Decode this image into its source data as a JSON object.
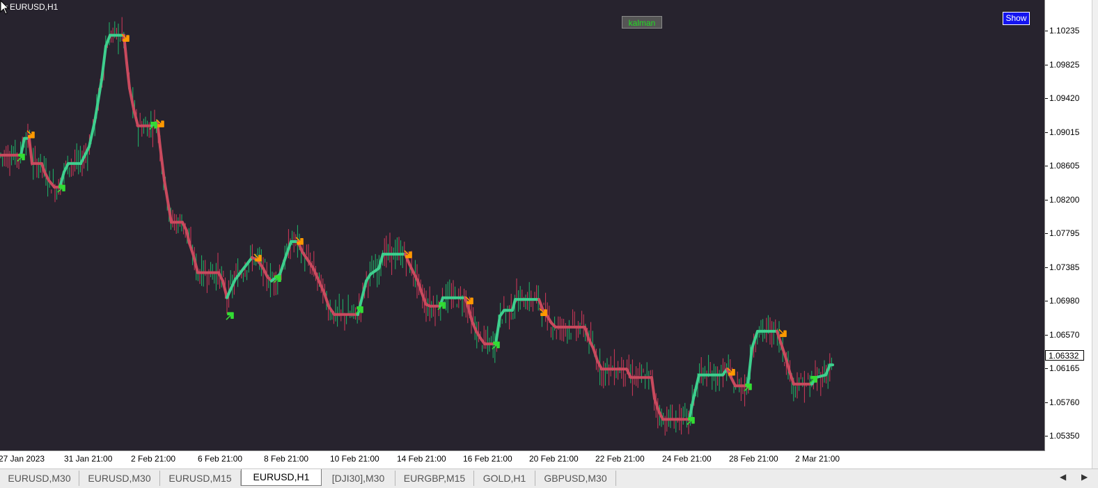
{
  "window": {
    "symbol_title": "EURUSD,H1"
  },
  "buttons": {
    "kalman": "kalman",
    "show": "Show"
  },
  "price_axis": {
    "labels": [
      "1.10235",
      "1.09825",
      "1.09420",
      "1.09015",
      "1.08605",
      "1.08200",
      "1.07795",
      "1.07385",
      "1.06980",
      "1.06570",
      "1.06165",
      "1.05760",
      "1.05350"
    ],
    "current_price": "1.06332"
  },
  "time_axis": {
    "labels": [
      "27 Jan 2023",
      "31 Jan 21:00",
      "2 Feb 21:00",
      "6 Feb 21:00",
      "8 Feb 21:00",
      "10 Feb 21:00",
      "14 Feb 21:00",
      "16 Feb 21:00",
      "20 Feb 21:00",
      "22 Feb 21:00",
      "24 Feb 21:00",
      "28 Feb 21:00",
      "2 Mar 21:00"
    ]
  },
  "tabs": [
    {
      "label": "EURUSD,M30",
      "active": false
    },
    {
      "label": "EURUSD,M30",
      "active": false
    },
    {
      "label": "EURUSD,M15",
      "active": false
    },
    {
      "label": "EURUSD,H1",
      "active": true
    },
    {
      "label": "[DJI30],M30",
      "active": false
    },
    {
      "label": "EURGBP,M15",
      "active": false
    },
    {
      "label": "GOLD,H1",
      "active": false
    },
    {
      "label": "GBPUSD,M30",
      "active": false
    }
  ],
  "nav": {
    "left": "◀",
    "right": "▶"
  },
  "colors": {
    "background": "#27232e",
    "uptrend_line": "#3ecf8e",
    "downtrend_line": "#c94a5e",
    "buy_arrow": "#33dd33",
    "sell_arrow": "#ff9900",
    "candle_up": "#1fb86a",
    "candle_down": "#d4385a"
  },
  "chart_data": {
    "type": "line",
    "ylim": [
      1.0518,
      1.1055
    ],
    "kalman_trend": [
      [
        0,
        1.087
      ],
      [
        30,
        1.087
      ],
      [
        35,
        1.089
      ],
      [
        42,
        1.089
      ],
      [
        46,
        1.086
      ],
      [
        60,
        1.086
      ],
      [
        64,
        1.085
      ],
      [
        70,
        1.084
      ],
      [
        78,
        1.0832
      ],
      [
        86,
        1.0832
      ],
      [
        92,
        1.085
      ],
      [
        98,
        1.086
      ],
      [
        116,
        1.086
      ],
      [
        122,
        1.087
      ],
      [
        128,
        1.088
      ],
      [
        136,
        1.091
      ],
      [
        146,
        1.096
      ],
      [
        152,
        1.1
      ],
      [
        158,
        1.1013
      ],
      [
        178,
        1.1013
      ],
      [
        182,
        1.098
      ],
      [
        186,
        1.095
      ],
      [
        192,
        1.0925
      ],
      [
        198,
        1.0905
      ],
      [
        218,
        1.0905
      ],
      [
        226,
        1.091
      ],
      [
        230,
        1.088
      ],
      [
        236,
        1.084
      ],
      [
        242,
        1.081
      ],
      [
        246,
        1.079
      ],
      [
        262,
        1.079
      ],
      [
        268,
        1.078
      ],
      [
        272,
        1.0765
      ],
      [
        278,
        1.075
      ],
      [
        284,
        1.073
      ],
      [
        314,
        1.073
      ],
      [
        320,
        1.072
      ],
      [
        326,
        1.07
      ],
      [
        330,
        1.0708
      ],
      [
        338,
        1.0722
      ],
      [
        350,
        1.0735
      ],
      [
        362,
        1.0748
      ],
      [
        370,
        1.0745
      ],
      [
        378,
        1.0735
      ],
      [
        384,
        1.0725
      ],
      [
        390,
        1.072
      ],
      [
        402,
        1.0728
      ],
      [
        410,
        1.0748
      ],
      [
        418,
        1.0767
      ],
      [
        428,
        1.0767
      ],
      [
        434,
        1.0755
      ],
      [
        442,
        1.0745
      ],
      [
        450,
        1.0735
      ],
      [
        458,
        1.072
      ],
      [
        466,
        1.0705
      ],
      [
        472,
        1.069
      ],
      [
        480,
        1.068
      ],
      [
        514,
        1.068
      ],
      [
        520,
        1.07
      ],
      [
        526,
        1.072
      ],
      [
        532,
        1.0728
      ],
      [
        544,
        1.0735
      ],
      [
        550,
        1.0752
      ],
      [
        582,
        1.0752
      ],
      [
        588,
        1.074
      ],
      [
        594,
        1.073
      ],
      [
        600,
        1.072
      ],
      [
        606,
        1.0705
      ],
      [
        612,
        1.0692
      ],
      [
        618,
        1.069
      ],
      [
        632,
        1.069
      ],
      [
        636,
        1.07
      ],
      [
        668,
        1.07
      ],
      [
        672,
        1.069
      ],
      [
        678,
        1.0672
      ],
      [
        684,
        1.066
      ],
      [
        690,
        1.0652
      ],
      [
        696,
        1.0645
      ],
      [
        712,
        1.0645
      ],
      [
        718,
        1.0678
      ],
      [
        724,
        1.0685
      ],
      [
        736,
        1.0685
      ],
      [
        740,
        1.0698
      ],
      [
        774,
        1.0698
      ],
      [
        780,
        1.0685
      ],
      [
        786,
        1.0678
      ],
      [
        792,
        1.067
      ],
      [
        798,
        1.0665
      ],
      [
        840,
        1.0665
      ],
      [
        846,
        1.065
      ],
      [
        852,
        1.064
      ],
      [
        858,
        1.0625
      ],
      [
        864,
        1.0615
      ],
      [
        900,
        1.0615
      ],
      [
        906,
        1.0605
      ],
      [
        936,
        1.0605
      ],
      [
        940,
        1.058
      ],
      [
        946,
        1.0565
      ],
      [
        952,
        1.0555
      ],
      [
        990,
        1.0555
      ],
      [
        996,
        1.058
      ],
      [
        1004,
        1.0608
      ],
      [
        1038,
        1.0608
      ],
      [
        1044,
        1.0615
      ],
      [
        1050,
        1.0605
      ],
      [
        1056,
        1.0595
      ],
      [
        1074,
        1.0595
      ],
      [
        1080,
        1.064
      ],
      [
        1088,
        1.066
      ],
      [
        1116,
        1.066
      ],
      [
        1122,
        1.0645
      ],
      [
        1128,
        1.063
      ],
      [
        1134,
        1.0612
      ],
      [
        1140,
        1.0597
      ],
      [
        1166,
        1.0597
      ],
      [
        1172,
        1.0605
      ],
      [
        1186,
        1.0608
      ],
      [
        1192,
        1.062
      ],
      [
        1196,
        1.062
      ]
    ],
    "sell_arrows": [
      [
        44,
        1.0895
      ],
      [
        180,
        1.101
      ],
      [
        230,
        1.0908
      ],
      [
        370,
        1.0748
      ],
      [
        430,
        1.0768
      ],
      [
        586,
        1.0752
      ],
      [
        674,
        1.0697
      ],
      [
        780,
        1.0683
      ],
      [
        1050,
        1.0612
      ],
      [
        1124,
        1.0658
      ]
    ],
    "buy_arrows": [
      [
        30,
        1.0867
      ],
      [
        88,
        1.083
      ],
      [
        220,
        1.0905
      ],
      [
        330,
        1.0678
      ],
      [
        398,
        1.0722
      ],
      [
        516,
        1.0685
      ],
      [
        634,
        1.069
      ],
      [
        712,
        1.0643
      ],
      [
        992,
        1.0553
      ],
      [
        1074,
        1.0593
      ],
      [
        1168,
        1.0602
      ]
    ]
  }
}
